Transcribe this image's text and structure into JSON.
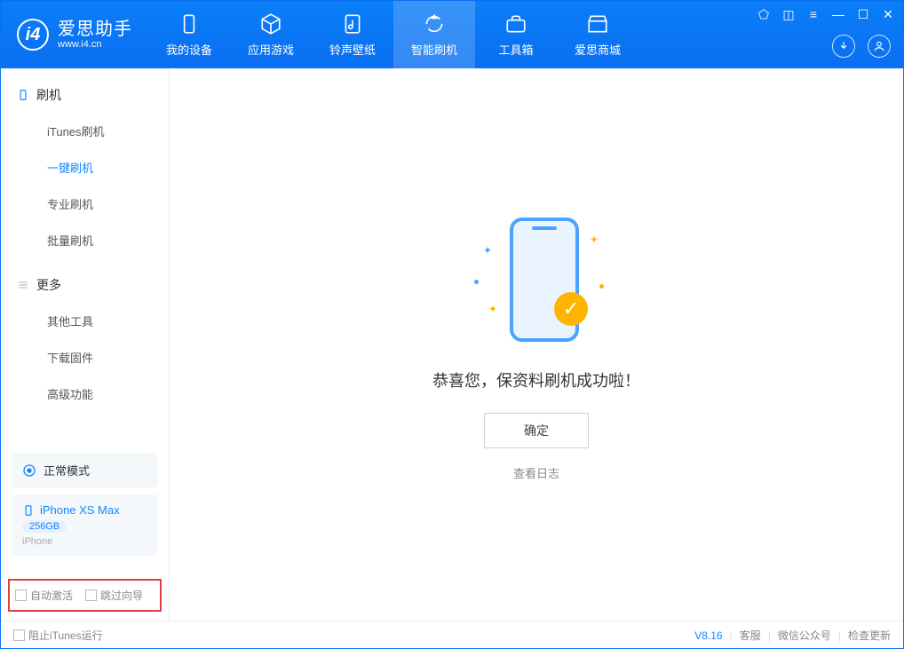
{
  "app": {
    "name": "爱思助手",
    "url": "www.i4.cn"
  },
  "nav": {
    "tabs": [
      {
        "label": "我的设备",
        "icon": "device"
      },
      {
        "label": "应用游戏",
        "icon": "cube"
      },
      {
        "label": "铃声壁纸",
        "icon": "music"
      },
      {
        "label": "智能刷机",
        "icon": "refresh",
        "active": true
      },
      {
        "label": "工具箱",
        "icon": "toolbox"
      },
      {
        "label": "爱思商城",
        "icon": "shop"
      }
    ]
  },
  "sidebar": {
    "section1": {
      "title": "刷机",
      "items": [
        {
          "label": "iTunes刷机"
        },
        {
          "label": "一键刷机",
          "active": true
        },
        {
          "label": "专业刷机"
        },
        {
          "label": "批量刷机"
        }
      ]
    },
    "section2": {
      "title": "更多",
      "items": [
        {
          "label": "其他工具"
        },
        {
          "label": "下载固件"
        },
        {
          "label": "高级功能"
        }
      ]
    },
    "mode": "正常模式",
    "device": {
      "name": "iPhone XS Max",
      "capacity": "256GB",
      "type": "iPhone"
    },
    "options": {
      "auto_activate": "自动激活",
      "skip_guide": "跳过向导"
    }
  },
  "main": {
    "success_text": "恭喜您，保资料刷机成功啦！",
    "ok_button": "确定",
    "log_link": "查看日志"
  },
  "footer": {
    "block_itunes": "阻止iTunes运行",
    "version": "V8.16",
    "links": [
      "客服",
      "微信公众号",
      "检查更新"
    ]
  }
}
